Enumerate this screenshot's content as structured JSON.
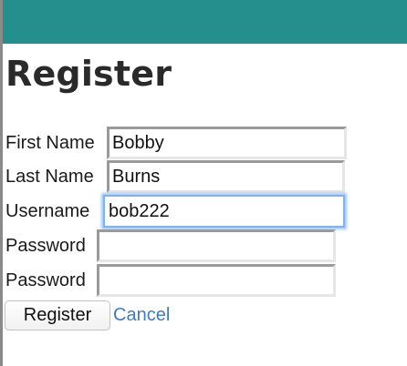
{
  "page": {
    "title": "Register"
  },
  "form": {
    "first_name": {
      "label": "First Name",
      "value": "Bobby"
    },
    "last_name": {
      "label": "Last Name",
      "value": "Burns"
    },
    "username": {
      "label": "Username",
      "value": "bob222"
    },
    "password": {
      "label": "Password",
      "value": ""
    },
    "password_confirm": {
      "label": "Password",
      "value": ""
    },
    "register_label": "Register",
    "cancel_label": "Cancel"
  },
  "colors": {
    "header": "#258f8d",
    "link": "#3f7bc2",
    "focus_ring": "#7fb2ef"
  }
}
